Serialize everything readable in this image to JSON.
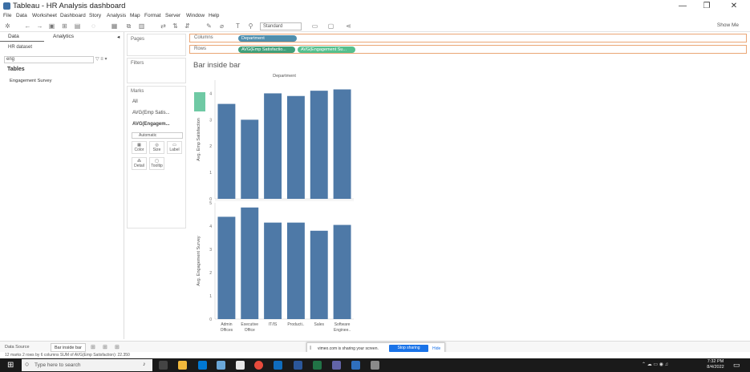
{
  "window": {
    "title": "Tableau - HR Analysis dashboard"
  },
  "menu": [
    "File",
    "Data",
    "Worksheet",
    "Dashboard",
    "Story",
    "Analysis",
    "Map",
    "Format",
    "Server",
    "Window",
    "Help"
  ],
  "toolbar": {
    "fit_select": "Standard",
    "show_me": "Show Me"
  },
  "data_pane": {
    "tab_data": "Data",
    "tab_analytics": "Analytics",
    "datasource": "HR dataset",
    "search_value": "eng",
    "tables_heading": "Tables",
    "field": "Engagement Survey"
  },
  "cards": {
    "pages": "Pages",
    "filters": "Filters",
    "marks": "Marks",
    "marks_items": [
      "All",
      "AVG(Emp Satis...",
      "AVG(Engagem..."
    ],
    "mark_type": "Automatic",
    "buttons": [
      "Color",
      "Size",
      "Label",
      "Detail",
      "Tooltip"
    ]
  },
  "shelves": {
    "columns_label": "Columns",
    "rows_label": "Rows",
    "columns_pill": "Department",
    "rows_pill_1": "AVG(Emp Satisfactio...",
    "rows_pill_2": "AVG(Engagement Su..."
  },
  "sheet": {
    "title": "Bar inside bar"
  },
  "chart_data": {
    "type": "bar",
    "header": "Department",
    "categories": [
      "Admin Offices",
      "Executive Office",
      "IT/IS",
      "Producti..",
      "Sales",
      "Software Enginee.."
    ],
    "series": [
      {
        "name": "Avg. Emp Satisfaction",
        "values": [
          3.6,
          3.0,
          4.0,
          3.9,
          4.1,
          4.15
        ],
        "yticks": [
          "0",
          "1",
          "2",
          "3",
          "4"
        ],
        "ylim": [
          0,
          4.5
        ]
      },
      {
        "name": "Avg. Engagement Survey",
        "values": [
          4.4,
          4.8,
          4.15,
          4.15,
          3.8,
          4.05
        ],
        "yticks": [
          "0",
          "1",
          "2",
          "3",
          "4",
          "5"
        ],
        "ylim": [
          0,
          5
        ]
      }
    ],
    "color": "#4e79a7"
  },
  "bottom": {
    "data_source": "Data Source",
    "sheet_tab": "Bar inside bar",
    "status": "12 marks    2 rows by 6 columns    SUM of AVG(Emp Satisfaction): 22.350",
    "share_text": "vimeo.com is sharing your screen.",
    "stop_sharing": "Stop sharing",
    "hide": "Hide"
  },
  "taskbar": {
    "search": "Type here to search",
    "time": "7:32 PM",
    "date": "8/4/2022"
  }
}
